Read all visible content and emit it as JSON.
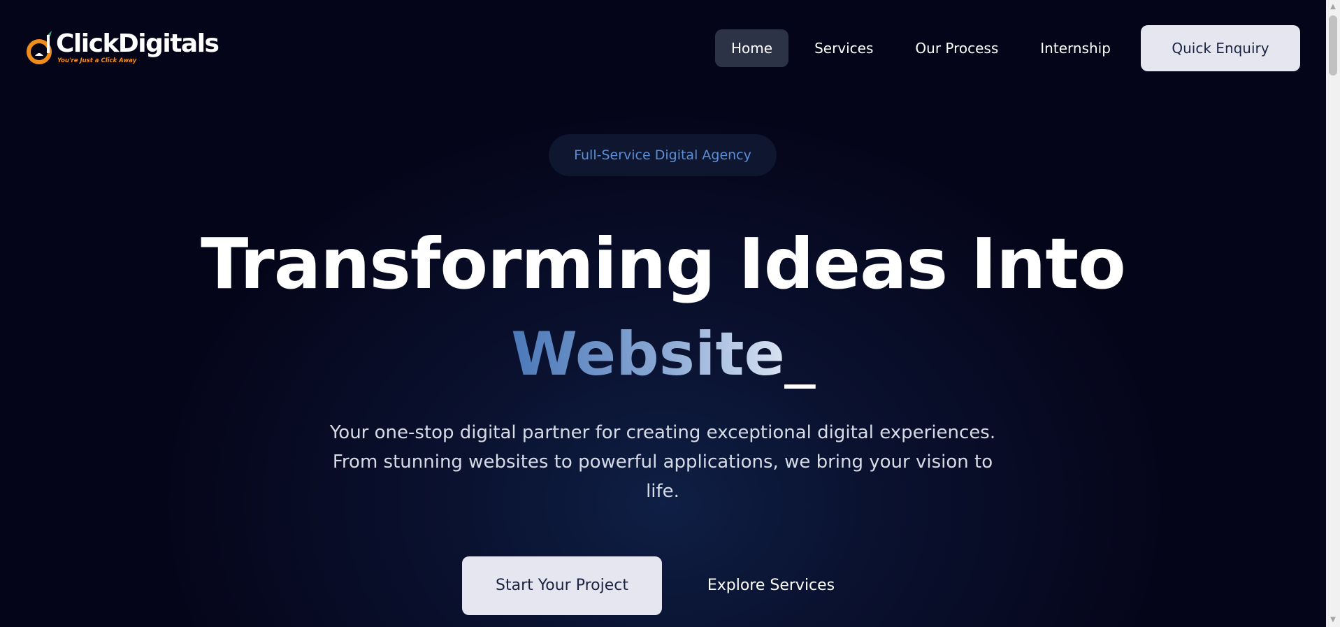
{
  "brand": {
    "name": "ClickDigitals",
    "tagline": "You're Just a Click Away"
  },
  "nav": {
    "items": [
      {
        "label": "Home",
        "active": true
      },
      {
        "label": "Services",
        "active": false
      },
      {
        "label": "Our Process",
        "active": false
      },
      {
        "label": "Internship",
        "active": false
      }
    ],
    "enquiry_label": "Quick Enquiry"
  },
  "hero": {
    "badge": "Full-Service Digital Agency",
    "headline": "Transforming Ideas Into",
    "typed_word": "Website",
    "cursor": "_",
    "subtitle": "Your one-stop digital partner for creating exceptional digital experiences. From stunning websites to powerful applications, we bring your vision to life.",
    "primary_cta": "Start Your Project",
    "secondary_cta": "Explore Services"
  },
  "colors": {
    "background": "#05051a",
    "accent_blue": "#5b8ed6",
    "button_bg": "#e6e6f0",
    "logo_orange": "#f08c1a"
  },
  "icons": {
    "logo": "clickdigitals-logo-icon",
    "scroll_up": "arrow-up-icon",
    "scroll_down": "arrow-down-icon"
  }
}
